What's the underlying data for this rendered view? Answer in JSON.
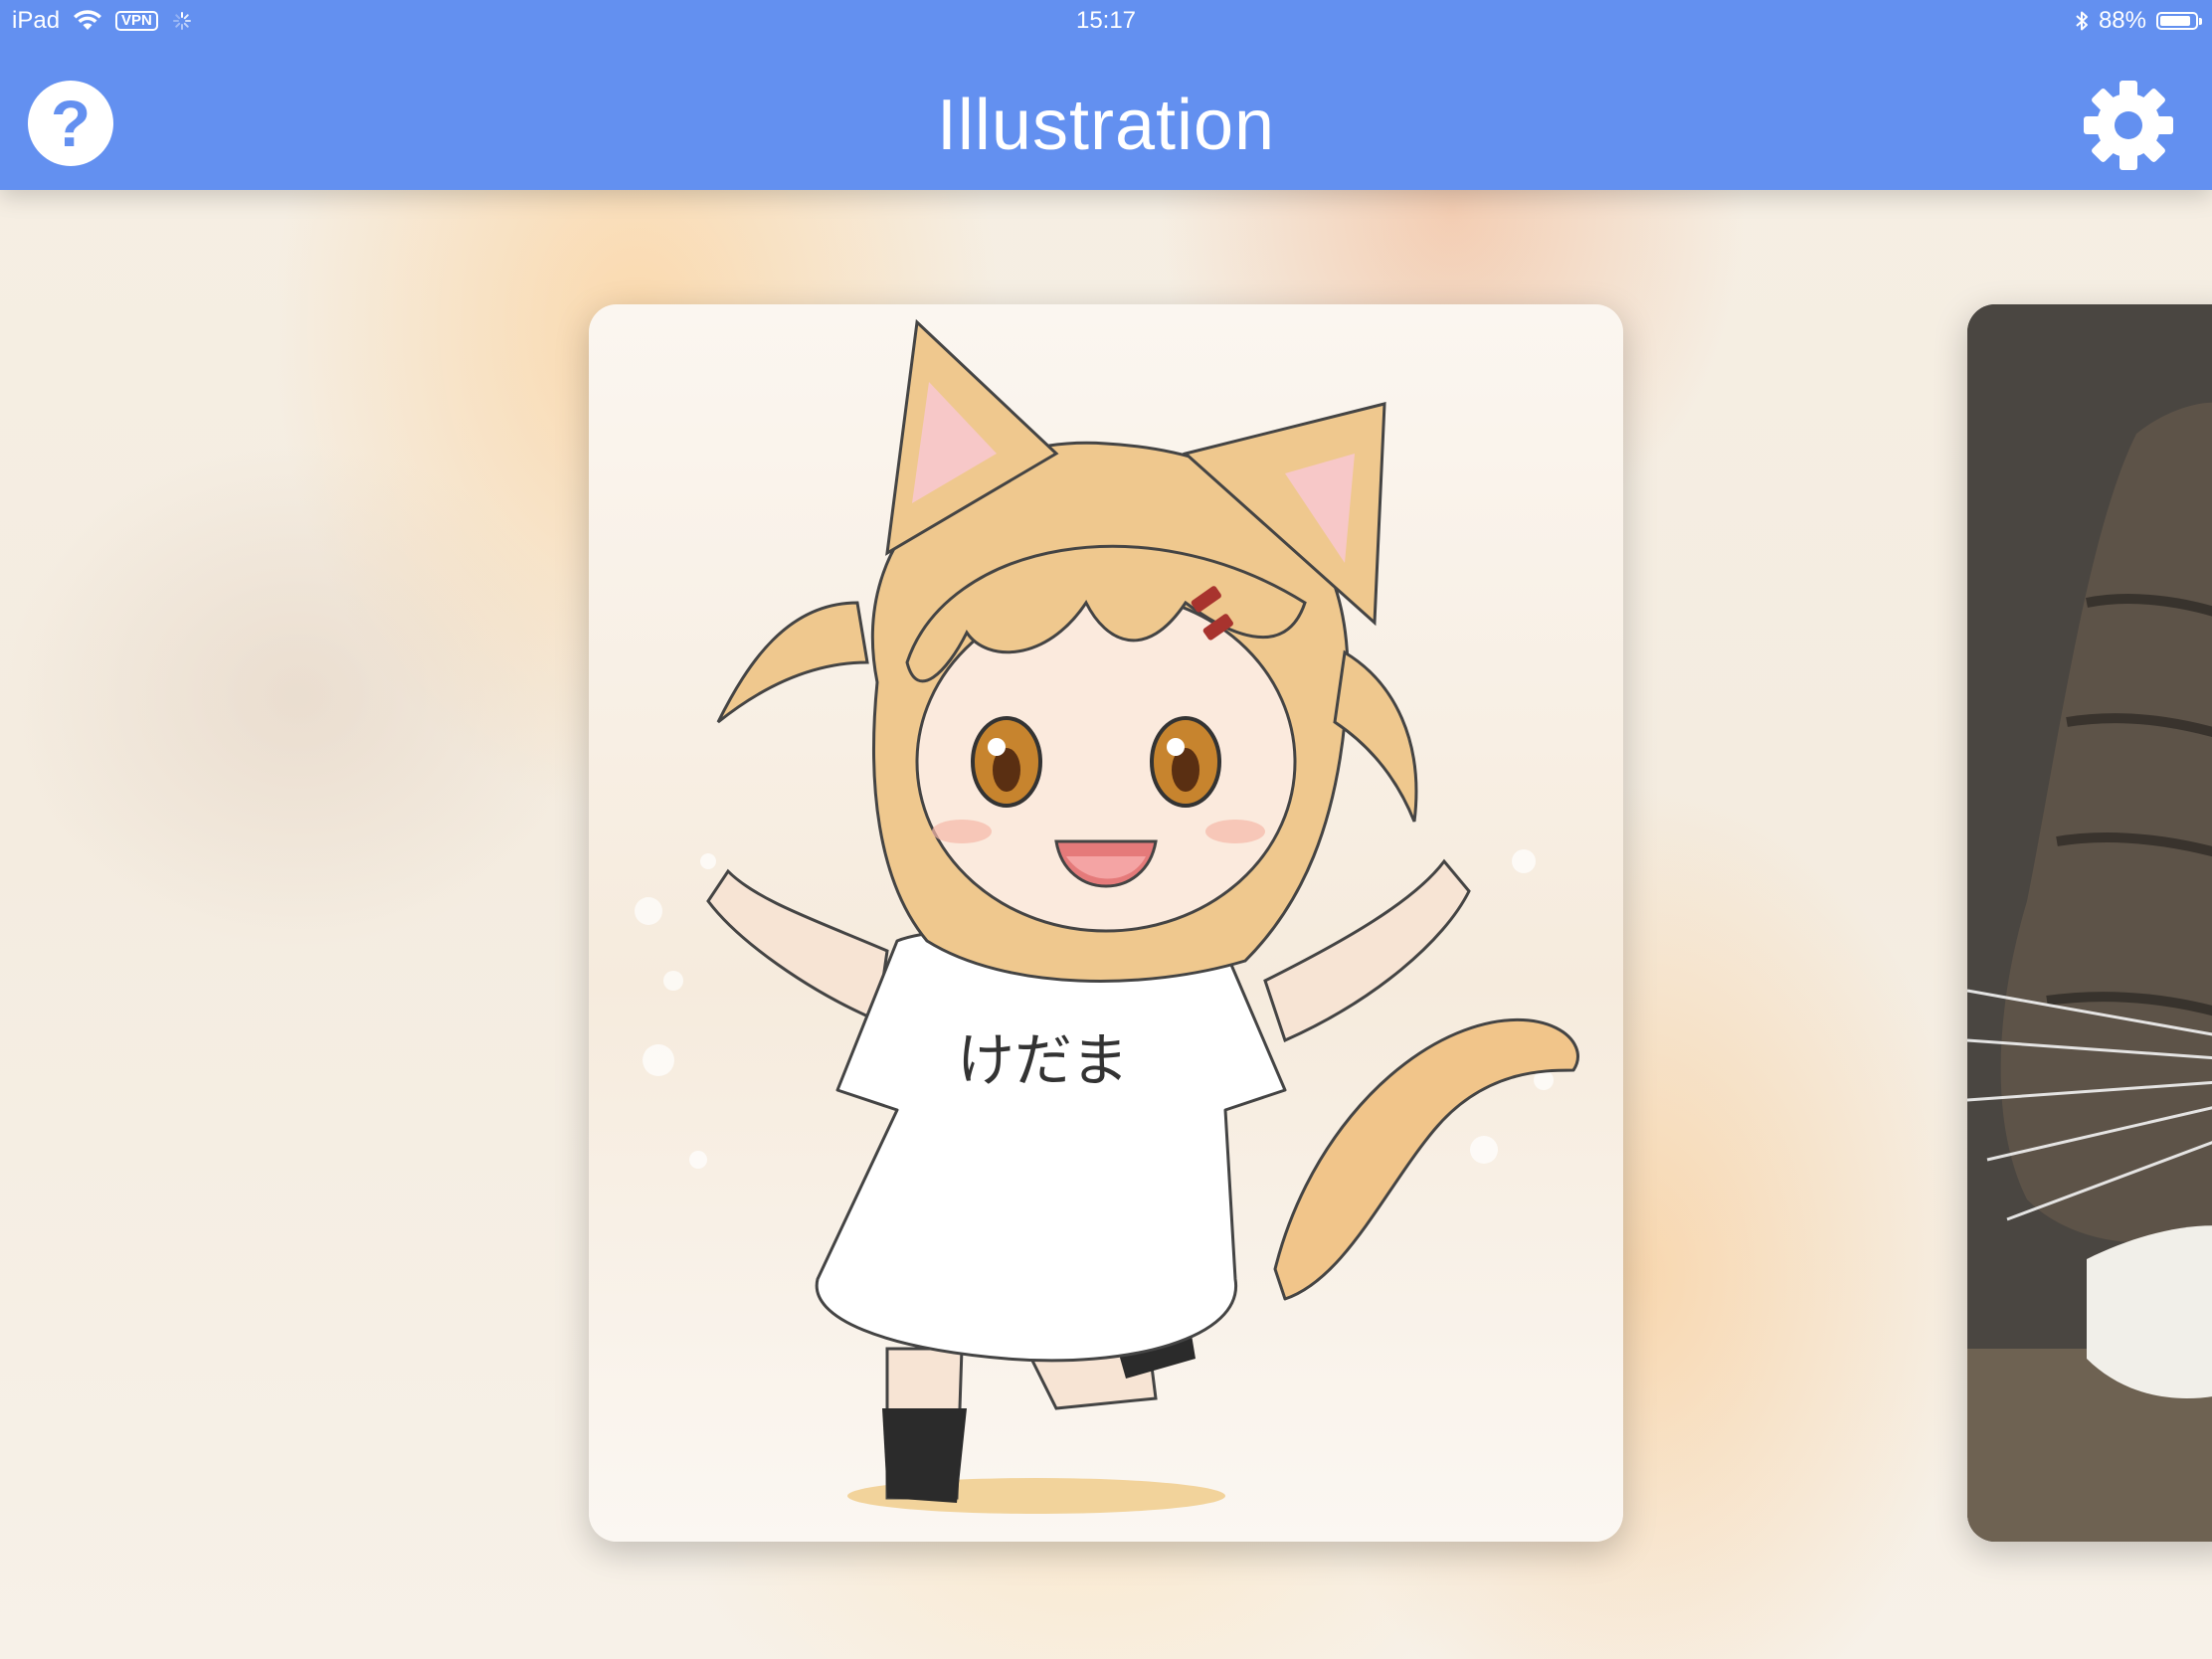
{
  "status_bar": {
    "device": "iPad",
    "vpn": "VPN",
    "time": "15:17",
    "battery": "88%",
    "battery_level": 0.88
  },
  "nav": {
    "title": "Illustration",
    "left_icon": "help-icon",
    "right_icon": "gear-icon"
  },
  "carousel": {
    "cards": [
      {
        "kind": "illustration",
        "shirt_text": "けだま"
      },
      {
        "kind": "photo"
      }
    ]
  },
  "colors": {
    "nav_background": "#6390f0",
    "nav_foreground": "#ffffff"
  }
}
